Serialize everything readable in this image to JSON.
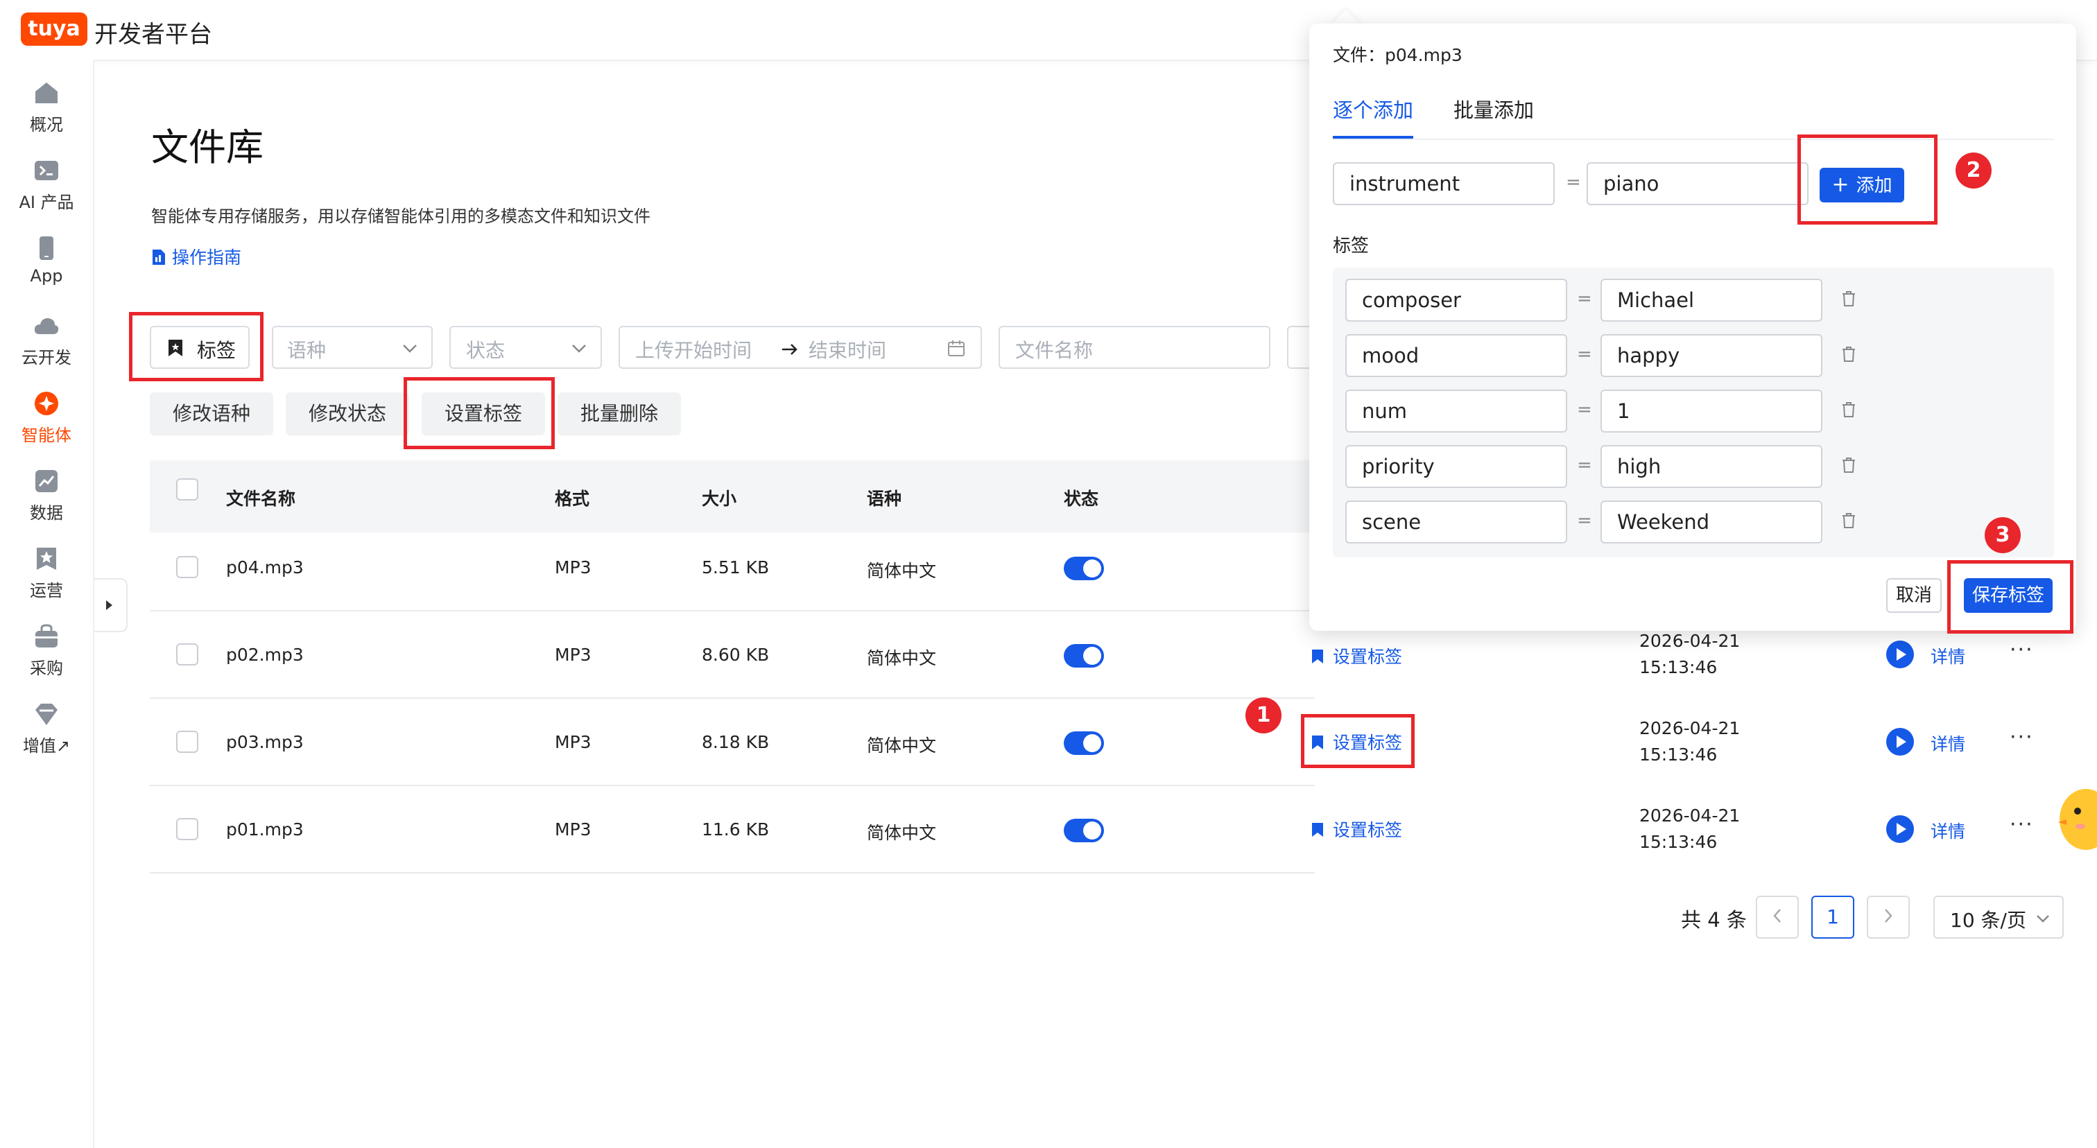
{
  "app": {
    "logo_text": "tuya",
    "platform_title": "开发者平台",
    "brand_color": "#ff4800",
    "accent_color": "#1559e6"
  },
  "sidebar": {
    "items": [
      {
        "label": "概况",
        "icon": "home-icon"
      },
      {
        "label": "AI 产品",
        "icon": "terminal-icon"
      },
      {
        "label": "App",
        "icon": "phone-icon"
      },
      {
        "label": "云开发",
        "icon": "cloud-icon"
      },
      {
        "label": "智能体",
        "icon": "agent-icon",
        "active": true
      },
      {
        "label": "数据",
        "icon": "chart-icon"
      },
      {
        "label": "运营",
        "icon": "star-badge-icon"
      },
      {
        "label": "采购",
        "icon": "cart-icon"
      },
      {
        "label": "增值↗",
        "icon": "diamond-icon"
      }
    ]
  },
  "page": {
    "title": "文件库",
    "description": "智能体专用存储服务，用以存储智能体引用的多模态文件和知识文件",
    "guide_link": "操作指南"
  },
  "filters": {
    "tag_button": "标签",
    "language_placeholder": "语种",
    "status_placeholder": "状态",
    "start_time_placeholder": "上传开始时间",
    "end_time_placeholder": "结束时间",
    "filename_placeholder": "文件名称"
  },
  "actions": {
    "modify_language": "修改语种",
    "modify_status": "修改状态",
    "set_tags": "设置标签",
    "batch_delete": "批量删除"
  },
  "table": {
    "headers": {
      "name": "文件名称",
      "format": "格式",
      "size": "大小",
      "language": "语种",
      "status": "状态"
    },
    "rows": [
      {
        "name": "p04.mp3",
        "format": "MP3",
        "size": "5.51 KB",
        "language": "简体中文",
        "enabled": true
      },
      {
        "name": "p02.mp3",
        "format": "MP3",
        "size": "8.60 KB",
        "language": "简体中文",
        "enabled": true,
        "tag_action": "设置标签",
        "date": "2026-04-21",
        "time": "15:13:46",
        "detail": "详情",
        "more": "···"
      },
      {
        "name": "p03.mp3",
        "format": "MP3",
        "size": "8.18 KB",
        "language": "简体中文",
        "enabled": true,
        "tag_action": "设置标签",
        "date": "2026-04-21",
        "time": "15:13:46",
        "detail": "详情",
        "more": "···"
      },
      {
        "name": "p01.mp3",
        "format": "MP3",
        "size": "11.6 KB",
        "language": "简体中文",
        "enabled": true,
        "tag_action": "设置标签",
        "date": "2026-04-21",
        "time": "15:13:46",
        "detail": "详情",
        "more": "···"
      }
    ]
  },
  "pagination": {
    "total": "共 4 条",
    "current_page": "1",
    "page_size": "10 条/页"
  },
  "popover": {
    "file_label": "文件：p04.mp3",
    "tabs": [
      "逐个添加",
      "批量添加"
    ],
    "active_tab": 0,
    "new_key": "instrument",
    "new_value": "piano",
    "add_button": "添加",
    "tags_title": "标签",
    "tags": [
      {
        "key": "composer",
        "value": "Michael"
      },
      {
        "key": "mood",
        "value": "happy"
      },
      {
        "key": "num",
        "value": "1"
      },
      {
        "key": "priority",
        "value": "high"
      },
      {
        "key": "scene",
        "value": "Weekend"
      }
    ],
    "equals": "=",
    "cancel_button": "取消",
    "save_button": "保存标签"
  },
  "annotations": {
    "step1": "1",
    "step2": "2",
    "step3": "3",
    "highlight_color": "#e8262c"
  }
}
